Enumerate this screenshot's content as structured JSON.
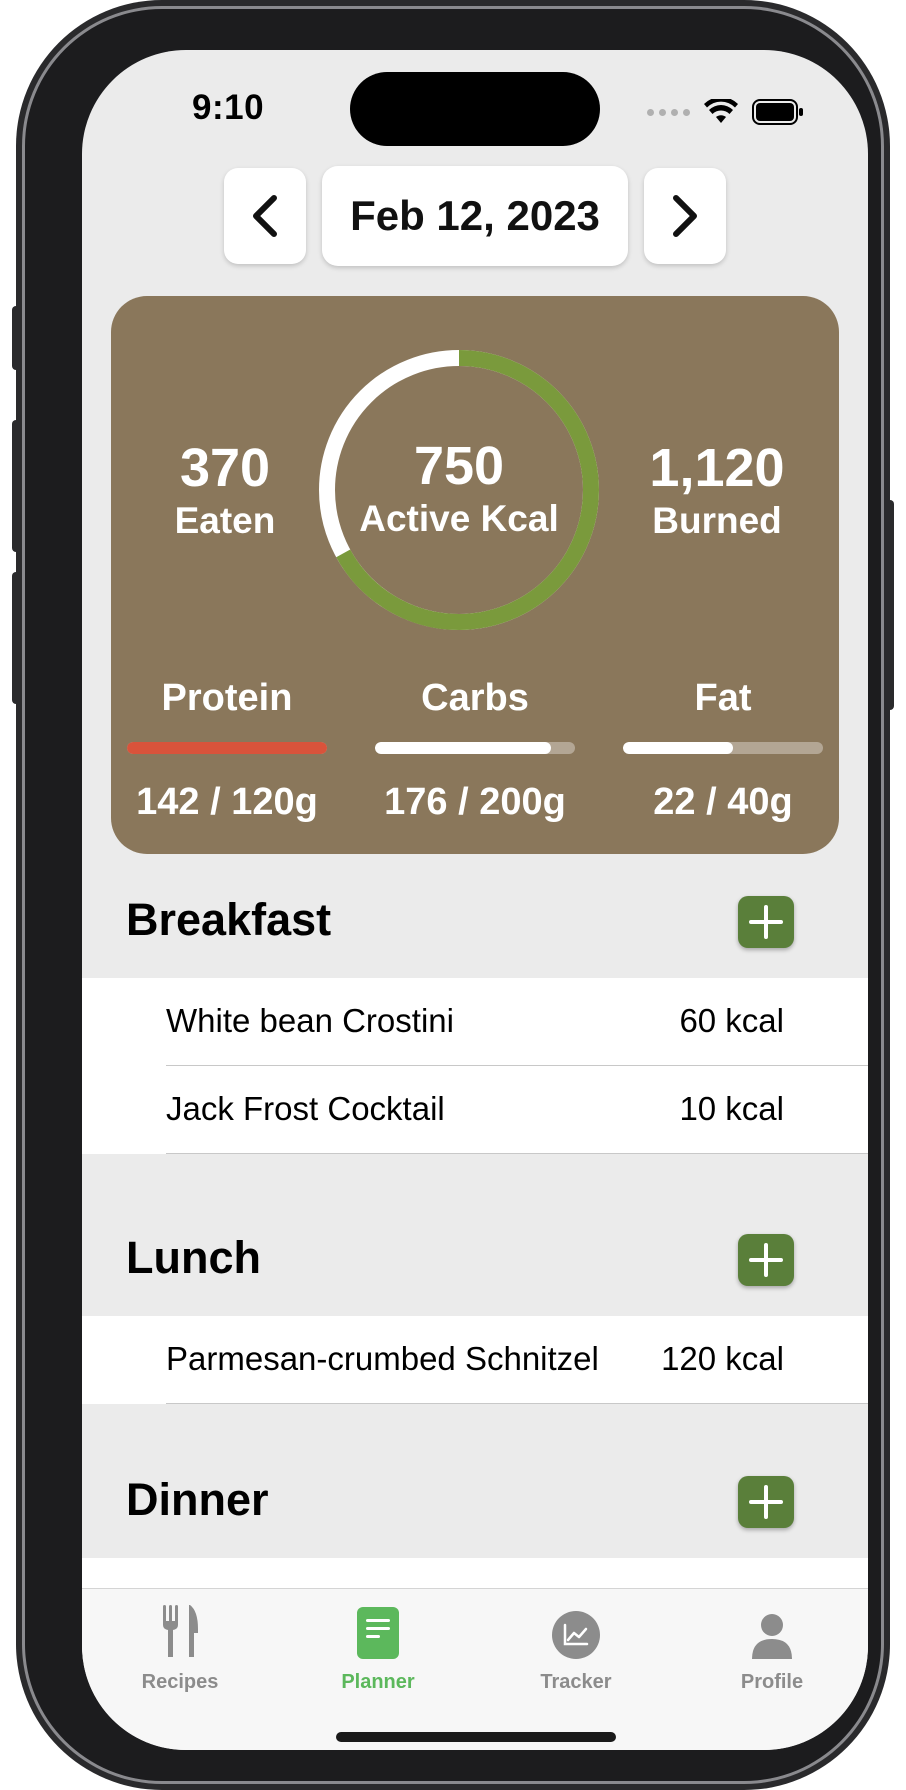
{
  "status_bar": {
    "time": "9:10"
  },
  "date_nav": {
    "date": "Feb 12, 2023"
  },
  "summary": {
    "eaten_value": "370",
    "eaten_label": "Eaten",
    "active_value": "750",
    "active_label": "Active Kcal",
    "burned_value": "1,120",
    "burned_label": "Burned",
    "ring_progress": 0.67,
    "colors": {
      "card": "#8a775b",
      "ring": "#7a9a3c",
      "ring_track": "#ffffff",
      "over_limit": "#d9533b"
    },
    "macros": [
      {
        "name": "Protein",
        "value": "142 / 120g",
        "progress": 1.0,
        "over": true
      },
      {
        "name": "Carbs",
        "value": "176 / 200g",
        "progress": 0.88,
        "over": false
      },
      {
        "name": "Fat",
        "value": "22 / 40g",
        "progress": 0.55,
        "over": false
      }
    ]
  },
  "meals": [
    {
      "title": "Breakfast",
      "items": [
        {
          "name": "White bean Crostini",
          "kcal": "60 kcal"
        },
        {
          "name": "Jack Frost Cocktail",
          "kcal": "10 kcal"
        }
      ]
    },
    {
      "title": "Lunch",
      "items": [
        {
          "name": "Parmesan-crumbed Schnitzel",
          "kcal": "120 kcal"
        }
      ]
    },
    {
      "title": "Dinner",
      "items": []
    }
  ],
  "tab_bar": {
    "active_color": "#5cb85c",
    "tabs": [
      {
        "label": "Recipes",
        "icon": "fork-knife-icon"
      },
      {
        "label": "Planner",
        "icon": "document-icon"
      },
      {
        "label": "Tracker",
        "icon": "chart-icon"
      },
      {
        "label": "Profile",
        "icon": "person-icon"
      }
    ]
  }
}
